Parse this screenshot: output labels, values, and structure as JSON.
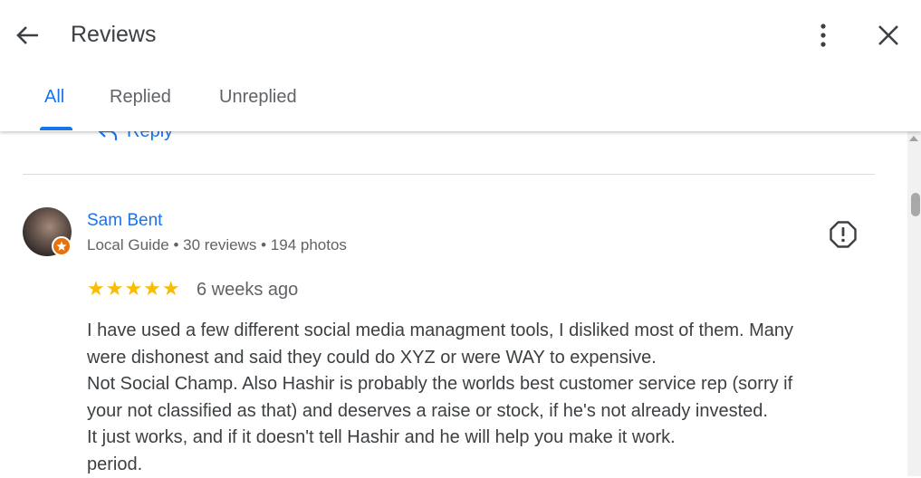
{
  "header": {
    "title": "Reviews",
    "icons": {
      "back": "arrow-back-icon",
      "more": "more-vert-icon",
      "close": "close-icon"
    }
  },
  "tabs": [
    {
      "label": "All",
      "active": true
    },
    {
      "label": "Replied",
      "active": false
    },
    {
      "label": "Unreplied",
      "active": false
    }
  ],
  "previous_review": {
    "reply_label": "Reply"
  },
  "review": {
    "author": "Sam Bent",
    "meta": "Local Guide • 30 reviews • 194 photos",
    "rating": 5,
    "stars": "★★★★★",
    "time": "6 weeks ago",
    "lines": [
      "I have used a few different social media managment tools, I disliked most of them. Many",
      "were dishonest and said they could do XYZ or were WAY to expensive.",
      "Not Social Champ. Also Hashir is probably the worlds best customer service rep (sorry if",
      "your not classified as that) and deserves a raise or stock, if he's not already invested.",
      "It just works, and if it doesn't tell Hashir and he will help you make it work.",
      "period."
    ]
  },
  "colors": {
    "accent": "#1a73e8",
    "star": "#fbbc04",
    "text": "#3c4043",
    "secondary_text": "#5f6368",
    "badge": "#e8710a"
  }
}
